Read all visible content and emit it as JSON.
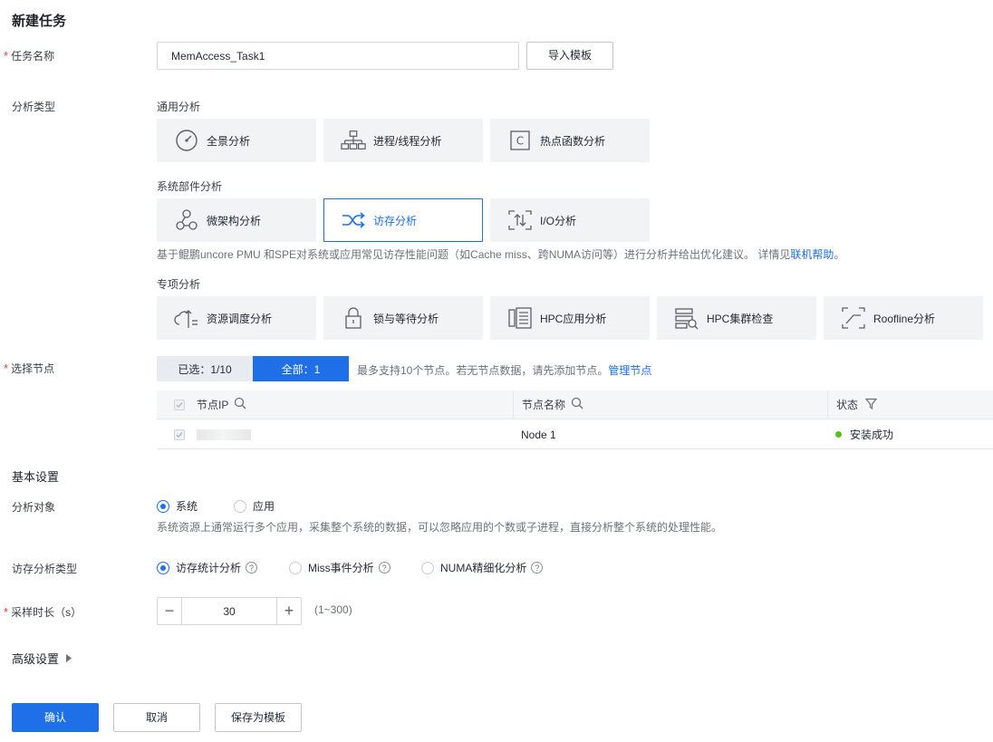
{
  "page_title": "新建任务",
  "task_name": {
    "label": "任务名称",
    "value": "MemAccess_Task1",
    "import_button": "导入模板"
  },
  "analysis_type": {
    "label": "分析类型",
    "general": {
      "title": "通用分析",
      "items": [
        "全景分析",
        "进程/线程分析",
        "热点函数分析"
      ]
    },
    "system": {
      "title": "系统部件分析",
      "items": [
        "微架构分析",
        "访存分析",
        "I/O分析"
      ]
    },
    "description": "基于鲲鹏uncore PMU 和SPE对系统或应用常见访存性能问题（如Cache miss、跨NUMA访问等）进行分析并给出优化建议。 详情见",
    "description_link": "联机帮助",
    "description_end": "。",
    "special": {
      "title": "专项分析",
      "items": [
        "资源调度分析",
        "锁与等待分析",
        "HPC应用分析",
        "HPC集群检查",
        "Roofline分析"
      ]
    }
  },
  "nodes": {
    "label": "选择节点",
    "selected_tab": "已选：1/10",
    "all_tab": "全部：1",
    "hint": "最多支持10个节点。若无节点数据，请先添加节点。",
    "manage_link": "管理节点",
    "columns": [
      "节点IP",
      "节点名称",
      "状态"
    ],
    "rows": [
      {
        "ip": "",
        "name": "Node 1",
        "status": "安装成功"
      }
    ],
    "status_color": "#52c41a"
  },
  "basic": {
    "title": "基本设置",
    "target": {
      "label": "分析对象",
      "options": [
        "系统",
        "应用"
      ],
      "desc": "系统资源上通常运行多个应用，采集整个系统的数据，可以忽略应用的个数或子进程，直接分析整个系统的处理性能。"
    },
    "mem_type": {
      "label": "访存分析类型",
      "options": [
        "访存统计分析",
        "Miss事件分析",
        "NUMA精细化分析"
      ]
    },
    "duration": {
      "label": "采样时长（s）",
      "value": "30",
      "range": "(1~300)",
      "minus": "−",
      "plus": "+"
    }
  },
  "advanced": {
    "label": "高级设置"
  },
  "footer": {
    "confirm": "确认",
    "cancel": "取消",
    "save_template": "保存为模板"
  },
  "colors": {
    "primary": "#1e6fe8",
    "required": "#e53935",
    "card_bg": "#f2f3f5"
  }
}
